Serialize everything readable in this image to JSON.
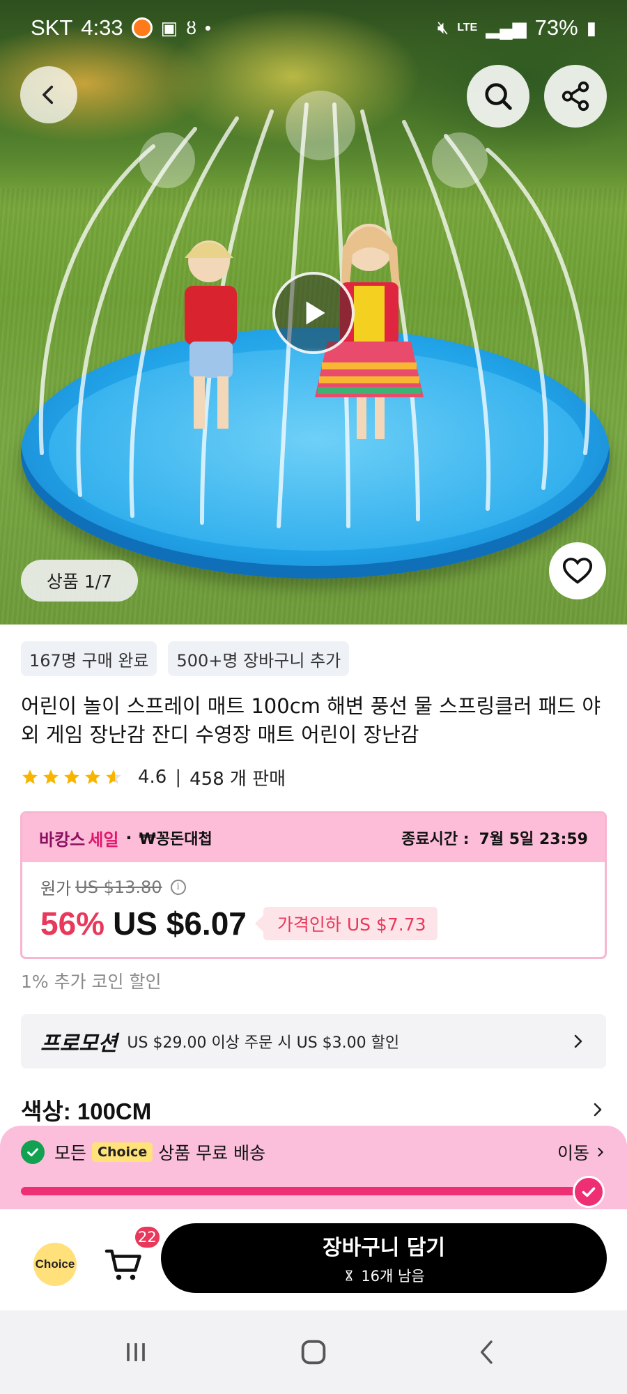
{
  "status_bar": {
    "carrier": "SKT",
    "time": "4:33",
    "network": "LTE",
    "battery": "73%"
  },
  "hero": {
    "photo_counter": "상품 1/7"
  },
  "tags": [
    "167명 구매 완료",
    "500+명 장바구니 추가"
  ],
  "product": {
    "title": "어린이 놀이 스프레이 매트 100cm 해변 풍선 물 스프링클러 패드 야외 게임 장난감 잔디 수영장 매트 어린이 장난감",
    "rating": 4.6,
    "rating_text": "4.6",
    "sales": "458 개 판매"
  },
  "sale": {
    "name_part1": "바캉스",
    "name_part2": "세일",
    "sub": "₩꽁돈대첩",
    "end_label": "종료시간 :",
    "end_time": "7월 5일 23:59",
    "original_label": "원가",
    "original_price": "US $13.80",
    "discount": "56%",
    "price": "US $6.07",
    "price_drop": "가격인하 US $7.73"
  },
  "coin_discount": "1% 추가 코인 할인",
  "promotion": {
    "label": "프로모션",
    "text": "US $29.00 이상 주문 시 US $3.00 할인"
  },
  "color": {
    "label": "색상: 100CM"
  },
  "free_shipping": {
    "text_before": "모든",
    "chip": "Choice",
    "text_after": "상품 무료 배송",
    "move": "이동",
    "progress": 1.0
  },
  "bottom": {
    "choice_logo": "Choice",
    "cart_count": "22",
    "add_to_cart": "장바구니 담기",
    "stock": "16개 남음"
  },
  "colors": {
    "accent_pink": "#ee2f73",
    "sale_header": "#fdbdd8",
    "discount_red": "#e8385b",
    "star": "#f7b500"
  },
  "icons": [
    "back-icon",
    "search-icon",
    "share-icon",
    "play-icon",
    "heart-icon",
    "info-icon",
    "chevron-right-icon",
    "check-icon",
    "cart-icon",
    "hourglass-icon",
    "recents-icon",
    "home-icon",
    "nav-back-icon"
  ]
}
